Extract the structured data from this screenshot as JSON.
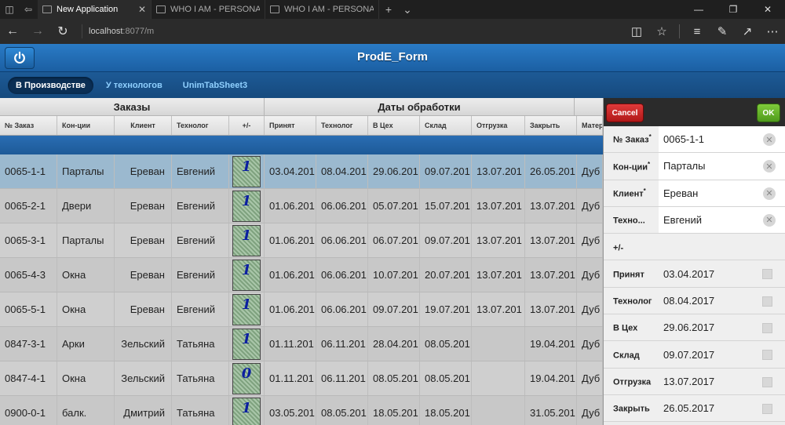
{
  "browser": {
    "tabs": [
      {
        "title": "New Application",
        "active": true
      },
      {
        "title": "WHO I AM - PERSONAL RES",
        "active": false
      },
      {
        "title": "WHO I AM - PERSONAL RES",
        "active": false
      }
    ],
    "address_host": "localhost",
    "address_path": ":8077/m"
  },
  "app": {
    "title": "ProdE_Form",
    "tabs": [
      "В Производстве",
      "У технологов",
      "UnimTabSheet3"
    ]
  },
  "grid": {
    "group_headers": [
      "Заказы",
      "Даты обработки"
    ],
    "columns": [
      "№ Заказ",
      "Кон-ции",
      "Клиент",
      "Технолог",
      "+/-",
      "Принят",
      "Технолог",
      "В Цех",
      "Склад",
      "Отгрузка",
      "Закрыть",
      "Матер"
    ],
    "rows": [
      [
        "0065-1-1",
        "Парталы",
        "Ереван",
        "Евгений",
        "1",
        "03.04.201",
        "08.04.201",
        "29.06.201",
        "09.07.201",
        "13.07.201",
        "26.05.201",
        "Дуб"
      ],
      [
        "0065-2-1",
        "Двери",
        "Ереван",
        "Евгений",
        "1",
        "01.06.201",
        "06.06.201",
        "05.07.201",
        "15.07.201",
        "13.07.201",
        "13.07.201",
        "Дуб"
      ],
      [
        "0065-3-1",
        "Парталы",
        "Ереван",
        "Евгений",
        "1",
        "01.06.201",
        "06.06.201",
        "06.07.201",
        "09.07.201",
        "13.07.201",
        "13.07.201",
        "Дуб"
      ],
      [
        "0065-4-3",
        "Окна",
        "Ереван",
        "Евгений",
        "1",
        "01.06.201",
        "06.06.201",
        "10.07.201",
        "20.07.201",
        "13.07.201",
        "13.07.201",
        "Дуб"
      ],
      [
        "0065-5-1",
        "Окна",
        "Ереван",
        "Евгений",
        "1",
        "01.06.201",
        "06.06.201",
        "09.07.201",
        "19.07.201",
        "13.07.201",
        "13.07.201",
        "Дуб"
      ],
      [
        "0847-3-1",
        "Арки",
        "Зельский",
        "Татьяна",
        "1",
        "01.11.201",
        "06.11.201",
        "28.04.201",
        "08.05.201",
        "",
        "19.04.201",
        "Дуб"
      ],
      [
        "0847-4-1",
        "Окна",
        "Зельский",
        "Татьяна",
        "0",
        "01.11.201",
        "06.11.201",
        "08.05.201",
        "08.05.201",
        "",
        "19.04.201",
        "Дуб"
      ],
      [
        "0900-0-1",
        "балк.",
        "Дмитрий",
        "Татьяна",
        "1",
        "03.05.201",
        "08.05.201",
        "18.05.201",
        "18.05.201",
        "",
        "31.05.201",
        "Дуб"
      ]
    ]
  },
  "panel": {
    "cancel_label": "Cancel",
    "ok_label": "OK",
    "fields": [
      {
        "label": "№ Заказ",
        "required": "*",
        "value": "0065-1-1",
        "kind": "text"
      },
      {
        "label": "Кон-ции",
        "required": "*",
        "value": "Парталы",
        "kind": "text"
      },
      {
        "label": "Клиент",
        "required": "*",
        "value": "Ереван",
        "kind": "text"
      },
      {
        "label": "Техно...",
        "required": "",
        "value": "Евгений",
        "kind": "text"
      },
      {
        "label": "+/-",
        "required": "",
        "value": "",
        "kind": "plain"
      },
      {
        "label": "Принят",
        "required": "",
        "value": "03.04.2017",
        "kind": "date"
      },
      {
        "label": "Технолог",
        "required": "",
        "value": "08.04.2017",
        "kind": "date"
      },
      {
        "label": "В Цех",
        "required": "",
        "value": "29.06.2017",
        "kind": "date"
      },
      {
        "label": "Склад",
        "required": "",
        "value": "09.07.2017",
        "kind": "date"
      },
      {
        "label": "Отгрузка",
        "required": "",
        "value": "13.07.2017",
        "kind": "date"
      },
      {
        "label": "Закрыть",
        "required": "",
        "value": "26.05.2017",
        "kind": "date"
      }
    ]
  }
}
